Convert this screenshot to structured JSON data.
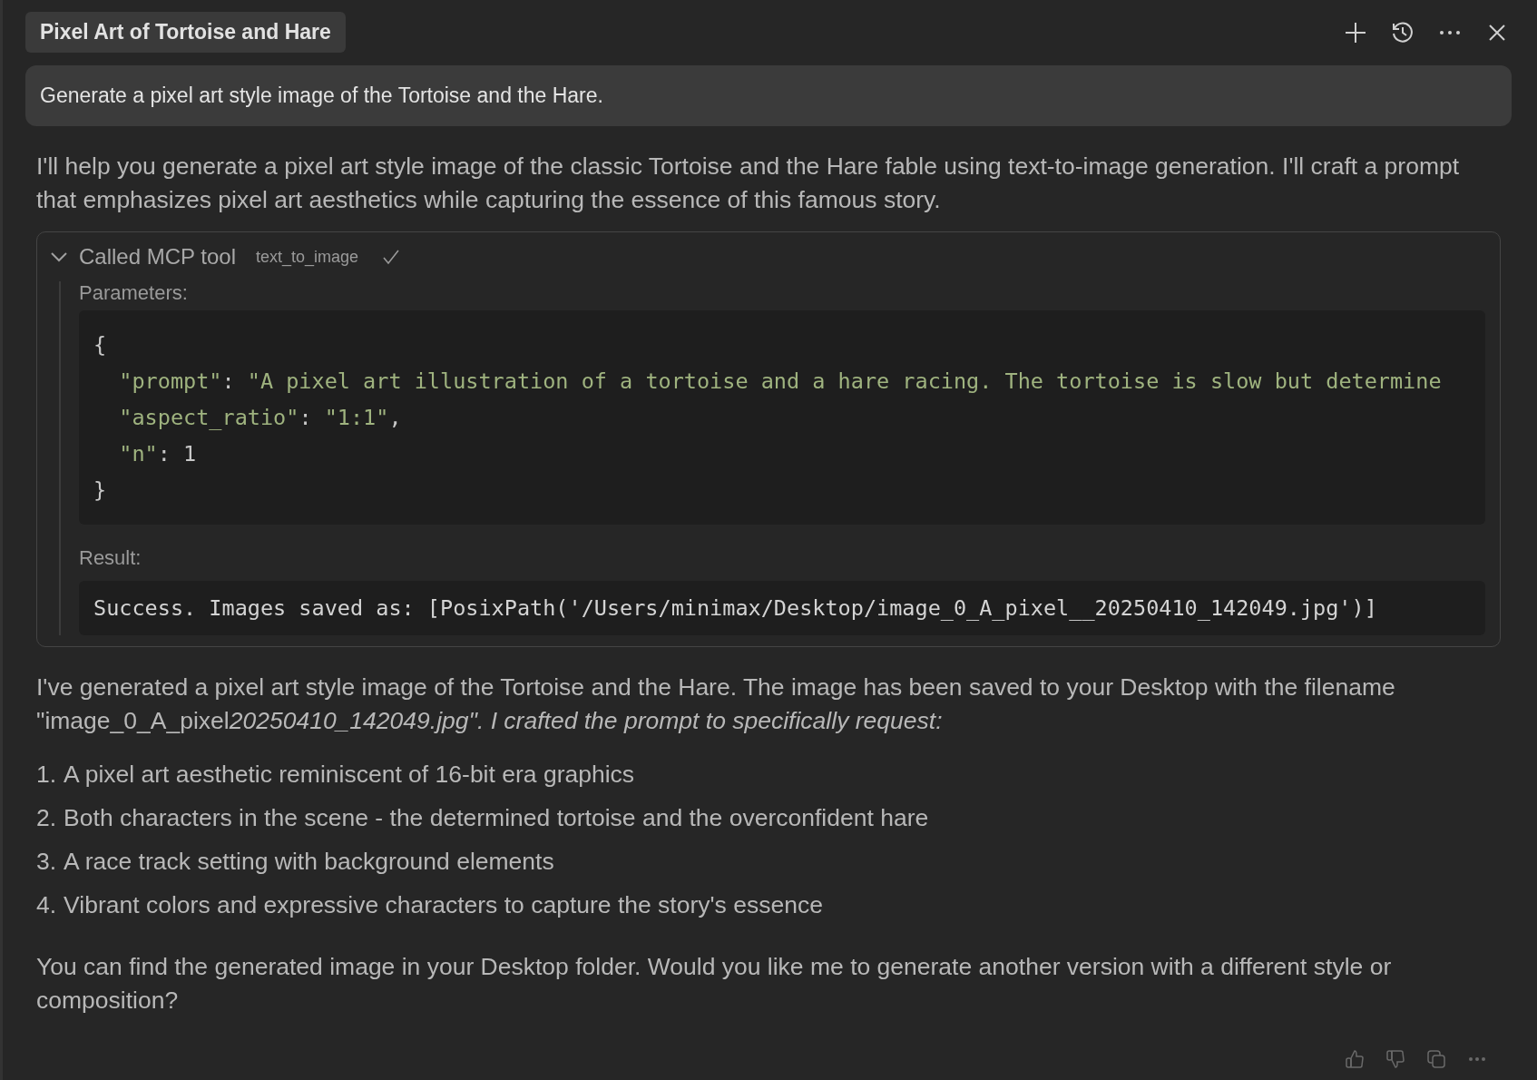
{
  "header": {
    "title": "Pixel Art of Tortoise and Hare",
    "actions": [
      {
        "kind": "plus"
      },
      {
        "kind": "history"
      },
      {
        "kind": "more"
      },
      {
        "kind": "close"
      }
    ]
  },
  "user_message": "Generate a pixel art style image of the Tortoise and the Hare.",
  "intro": "I'll help you generate a pixel art style image of the classic Tortoise and the Hare fable using text-to-image generation. I'll craft a prompt that emphasizes pixel art aesthetics while capturing the essence of this famous story.",
  "tool_call": {
    "expanded": true,
    "label": "Called MCP tool",
    "tool": "text_to_image",
    "done": true,
    "parameters_label": "Parameters:",
    "code": [
      [
        {
          "kind": "punct",
          "text": "{"
        }
      ],
      [
        {
          "kind": "key",
          "text": "  \"prompt\""
        },
        {
          "kind": "punct",
          "text": ": "
        },
        {
          "kind": "string",
          "text": "\"A pixel art illustration of a tortoise and a hare racing. The tortoise is slow but determine"
        }
      ],
      [
        {
          "kind": "key",
          "text": "  \"aspect_ratio\""
        },
        {
          "kind": "punct",
          "text": ": "
        },
        {
          "kind": "string",
          "text": "\"1:1\""
        },
        {
          "kind": "punct",
          "text": ","
        }
      ],
      [
        {
          "kind": "key",
          "text": "  \"n\""
        },
        {
          "kind": "punct",
          "text": ": "
        },
        {
          "kind": "number",
          "text": "1"
        }
      ],
      [
        {
          "kind": "punct",
          "text": "}"
        }
      ]
    ],
    "result_label": "Result:",
    "result": "Success. Images saved as: [PosixPath('/Users/minimax/Desktop/image_0_A_pixel__20250410_142049.jpg')]"
  },
  "response": "I've generated a pixel art style image of the Tortoise and the Hare. The image has been saved to your Desktop with the filename \"image_0_A_pixel",
  "response_italic": "20250410_142049.jpg\". I crafted the prompt to specifically request:",
  "list": [
    {
      "number": "1.",
      "text": "A pixel art aesthetic reminiscent of 16-bit era graphics"
    },
    {
      "number": "2.",
      "text": "Both characters in the scene - the determined tortoise and the overconfident hare"
    },
    {
      "number": "3.",
      "text": "A race track setting with background elements"
    },
    {
      "number": "4.",
      "text": "Vibrant colors and expressive characters to capture the story's essence"
    }
  ],
  "closing": "You can find the generated image in your Desktop folder. Would you like me to generate another version with a different style or composition?",
  "footer_actions": [
    {
      "kind": "thumbs-up"
    },
    {
      "kind": "thumbs-down"
    },
    {
      "kind": "copy"
    },
    {
      "kind": "more"
    }
  ]
}
